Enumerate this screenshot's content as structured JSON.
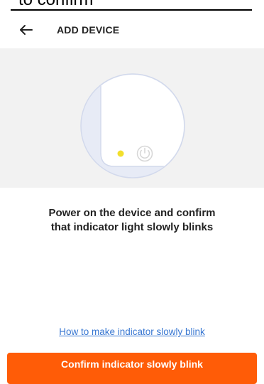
{
  "overlay": {
    "caption": "to confirm"
  },
  "header": {
    "back_icon": "back-arrow-icon",
    "title": "ADD DEVICE"
  },
  "illustration": {
    "device": "device-illustration",
    "indicator_light_color": "#f2df2c",
    "power_icon": "power-icon"
  },
  "instruction": {
    "line1": "Power on the device and confirm",
    "line2": "that indicator light slowly blinks"
  },
  "help_link": {
    "label": "How to make indicator slowly blink"
  },
  "confirm_button": {
    "label": "Confirm indicator slowly blink"
  },
  "colors": {
    "accent": "#ff5c07",
    "link": "#3877d2",
    "illustration_background": "#f2f2f2"
  }
}
